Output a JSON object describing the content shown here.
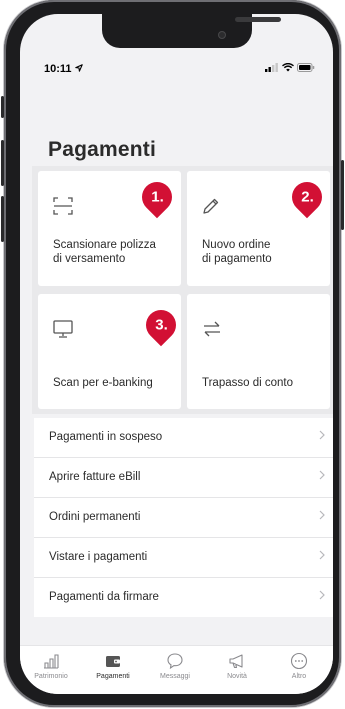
{
  "status_bar": {
    "time": "10:11"
  },
  "page": {
    "title": "Pagamenti"
  },
  "tiles": [
    {
      "label_line1": "Scansionare polizza",
      "label_line2": "di versamento",
      "icon": "scan-frame-icon",
      "marker": "1."
    },
    {
      "label_line1": "Nuovo ordine",
      "label_line2": "di pagamento",
      "icon": "pencil-icon",
      "marker": "2."
    },
    {
      "label_line1": "Scan per e-banking",
      "icon": "monitor-icon",
      "marker": "3."
    },
    {
      "label_line1": "Trapasso di conto",
      "icon": "transfer-arrows-icon"
    }
  ],
  "list": [
    {
      "label": "Pagamenti in sospeso"
    },
    {
      "label": "Aprire fatture eBill"
    },
    {
      "label": "Ordini permanenti"
    },
    {
      "label": "Vistare i pagamenti"
    },
    {
      "label": "Pagamenti da firmare"
    }
  ],
  "tabbar": [
    {
      "label": "Patrimonio",
      "icon": "bar-chart-icon"
    },
    {
      "label": "Pagamenti",
      "icon": "wallet-icon",
      "active": true
    },
    {
      "label": "Messaggi",
      "icon": "chat-bubble-icon"
    },
    {
      "label": "Novità",
      "icon": "megaphone-icon"
    },
    {
      "label": "Altro",
      "icon": "more-dots-icon"
    }
  ],
  "colors": {
    "accent_marker": "#d21034",
    "background": "#f2f2f4",
    "tile_bg": "#ffffff"
  }
}
